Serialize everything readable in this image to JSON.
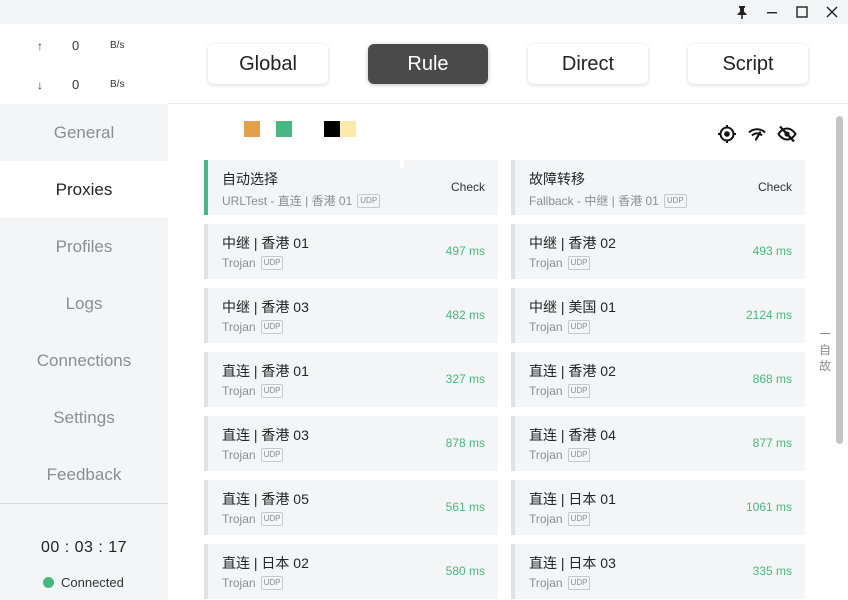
{
  "window_controls": {
    "pin": "pin-icon",
    "minimize": "minimize-icon",
    "maximize": "maximize-icon",
    "close": "close-icon"
  },
  "traffic": {
    "up": {
      "arrow": "↑",
      "value": "0",
      "unit": "B/s"
    },
    "down": {
      "arrow": "↓",
      "value": "0",
      "unit": "B/s"
    }
  },
  "sidebar": {
    "items": [
      {
        "label": "General"
      },
      {
        "label": "Proxies"
      },
      {
        "label": "Profiles"
      },
      {
        "label": "Logs"
      },
      {
        "label": "Connections"
      },
      {
        "label": "Settings"
      },
      {
        "label": "Feedback"
      }
    ],
    "active_index": 1,
    "timer": "00 : 03 : 17",
    "status": "Connected",
    "status_color": "#47b881"
  },
  "modes": {
    "items": [
      {
        "label": "Global"
      },
      {
        "label": "Rule"
      },
      {
        "label": "Direct"
      },
      {
        "label": "Script"
      }
    ],
    "active": "Rule"
  },
  "swatches": [
    "#e2a14a",
    "#47b881",
    "#000000",
    "#fde9a8"
  ],
  "tools": [
    "locate-icon",
    "wifi-speed-icon",
    "hide-icon"
  ],
  "proxies": [
    {
      "name": "自动选择",
      "type": "URLTest - 直连 | 香港 01",
      "udp": "UDP",
      "action": "Check",
      "selected": true
    },
    {
      "name": "故障转移",
      "type": "Fallback - 中继 | 香港 01",
      "udp": "UDP",
      "action": "Check"
    },
    {
      "name": "中继 | 香港 01",
      "type": "Trojan",
      "udp": "UDP",
      "latency": "497 ms"
    },
    {
      "name": "中继 | 香港 02",
      "type": "Trojan",
      "udp": "UDP",
      "latency": "493 ms"
    },
    {
      "name": "中继 | 香港 03",
      "type": "Trojan",
      "udp": "UDP",
      "latency": "482 ms"
    },
    {
      "name": "中继 | 美国 01",
      "type": "Trojan",
      "udp": "UDP",
      "latency": "2124 ms"
    },
    {
      "name": "直连 | 香港 01",
      "type": "Trojan",
      "udp": "UDP",
      "latency": "327 ms"
    },
    {
      "name": "直连 | 香港 02",
      "type": "Trojan",
      "udp": "UDP",
      "latency": "868 ms"
    },
    {
      "name": "直连 | 香港 03",
      "type": "Trojan",
      "udp": "UDP",
      "latency": "878 ms"
    },
    {
      "name": "直连 | 香港 04",
      "type": "Trojan",
      "udp": "UDP",
      "latency": "877 ms"
    },
    {
      "name": "直连 | 香港 05",
      "type": "Trojan",
      "udp": "UDP",
      "latency": "561 ms"
    },
    {
      "name": "直连 | 日本 01",
      "type": "Trojan",
      "udp": "UDP",
      "latency": "1061 ms"
    },
    {
      "name": "直连 | 日本 02",
      "type": "Trojan",
      "udp": "UDP",
      "latency": "580 ms"
    },
    {
      "name": "直连 | 日本 03",
      "type": "Trojan",
      "udp": "UDP",
      "latency": "335 ms"
    }
  ],
  "side_index": [
    "自",
    "故"
  ],
  "latency_color": "#47b881"
}
